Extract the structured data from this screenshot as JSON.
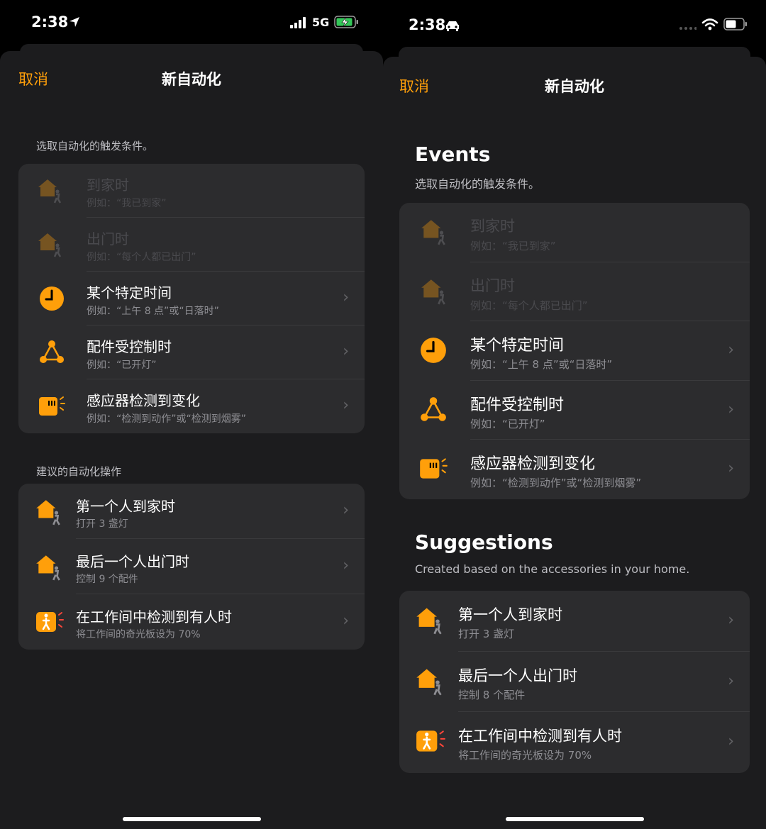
{
  "left": {
    "status": {
      "time": "2:38",
      "network": "5G"
    },
    "nav": {
      "cancel": "取消",
      "title": "新自动化"
    },
    "events_label": "选取自动化的触发条件。",
    "events": [
      {
        "title": "到家时",
        "subtitle": "例如：“我已到家”"
      },
      {
        "title": "出门时",
        "subtitle": "例如：“每个人都已出门”"
      },
      {
        "title": "某个特定时间",
        "subtitle": "例如：“上午 8 点”或“日落时”"
      },
      {
        "title": "配件受控制时",
        "subtitle": "例如：“已开灯”"
      },
      {
        "title": "感应器检测到变化",
        "subtitle": "例如：“检测到动作”或“检测到烟雾”"
      }
    ],
    "suggestions_label": "建议的自动化操作",
    "suggestions": [
      {
        "title": "第一个人到家时",
        "subtitle": "打开 3 盏灯"
      },
      {
        "title": "最后一个人出门时",
        "subtitle": "控制 9 个配件"
      },
      {
        "title": "在工作间中检测到有人时",
        "subtitle": "将工作间的奇光板设为 70%"
      }
    ]
  },
  "right": {
    "status": {
      "time": "2:38"
    },
    "nav": {
      "cancel": "取消",
      "title": "新自动化"
    },
    "events_title": "Events",
    "events_label": "选取自动化的触发条件。",
    "events": [
      {
        "title": "到家时",
        "subtitle": "例如：“我已到家”"
      },
      {
        "title": "出门时",
        "subtitle": "例如：“每个人都已出门”"
      },
      {
        "title": "某个特定时间",
        "subtitle": "例如：“上午 8 点”或“日落时”"
      },
      {
        "title": "配件受控制时",
        "subtitle": "例如：“已开灯”"
      },
      {
        "title": "感应器检测到变化",
        "subtitle": "例如：“检测到动作”或“检测到烟雾”"
      }
    ],
    "suggestions_title": "Suggestions",
    "suggestions_label": "Created based on the accessories in your home.",
    "suggestions": [
      {
        "title": "第一个人到家时",
        "subtitle": "打开 3 盏灯"
      },
      {
        "title": "最后一个人出门时",
        "subtitle": "控制 8 个配件"
      },
      {
        "title": "在工作间中检测到有人时",
        "subtitle": "将工作间的奇光板设为 70%"
      }
    ]
  },
  "colors": {
    "accent": "#ff9f0a",
    "background": "#1c1c1e",
    "card": "#2c2c2e",
    "alert": "#ff453a"
  },
  "icons": {
    "events": [
      "house-person-icon",
      "house-person-icon",
      "clock-icon",
      "accessory-triangle-icon",
      "sensor-icon"
    ],
    "suggestions": [
      "house-person-icon",
      "house-person-icon",
      "motion-sensor-icon"
    ],
    "chevron": "chevron-right-icon"
  }
}
